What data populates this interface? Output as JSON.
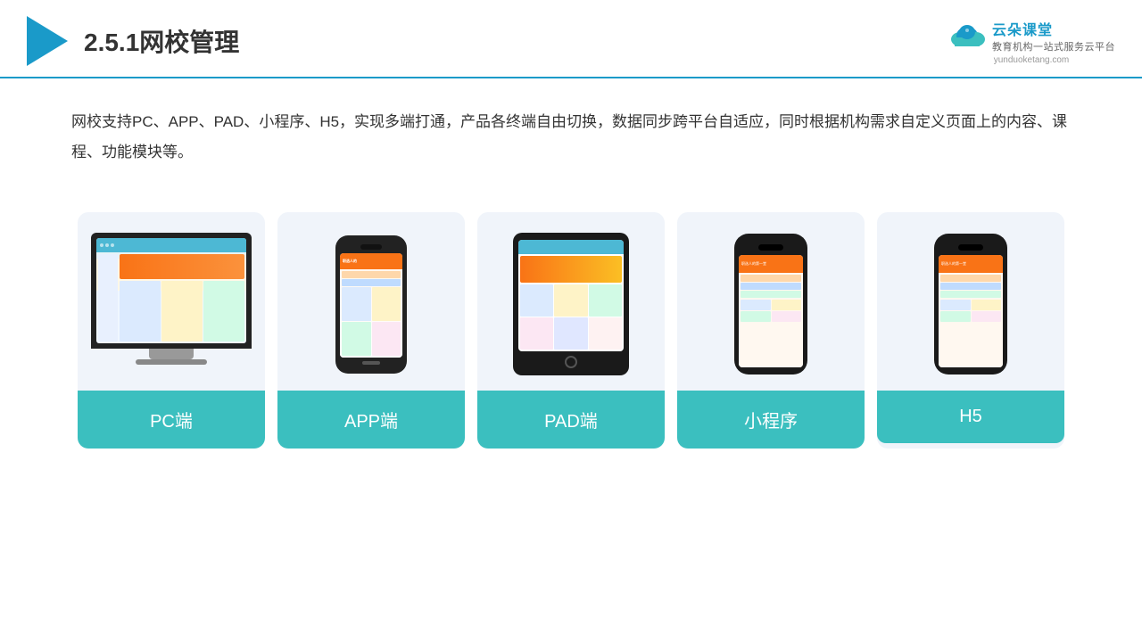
{
  "header": {
    "section_number": "2.5.1",
    "title": "网校管理",
    "brand": {
      "name": "云朵课堂",
      "url": "yunduoketang.com",
      "tagline": "教育机构一站式服务云平台"
    }
  },
  "description": {
    "text": "网校支持PC、APP、PAD、小程序、H5，实现多端打通，产品各终端自由切换，数据同步跨平台自适应，同时根据机构需求自定义页面上的内容、课程、功能模块等。"
  },
  "cards": [
    {
      "id": "pc",
      "label": "PC端"
    },
    {
      "id": "app",
      "label": "APP端"
    },
    {
      "id": "pad",
      "label": "PAD端"
    },
    {
      "id": "miniapp",
      "label": "小程序"
    },
    {
      "id": "h5",
      "label": "H5"
    }
  ],
  "colors": {
    "accent": "#1a9ac9",
    "card_bg": "#eef3fa",
    "label_bg": "#3bbfbf"
  }
}
